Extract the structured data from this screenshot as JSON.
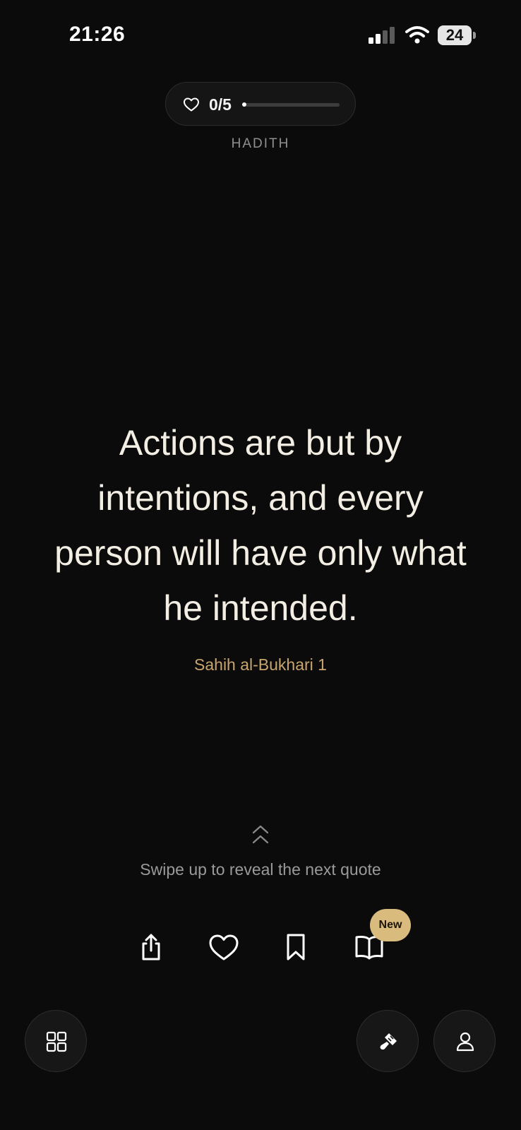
{
  "status_bar": {
    "time": "21:26",
    "battery": "24"
  },
  "progress": {
    "count_text": "0/5",
    "current": 0,
    "total": 5
  },
  "category": "HADITH",
  "quote": {
    "text": "Actions are but by intentions, and every person will have only what he intended.",
    "source": "Sahih al-Bukhari 1"
  },
  "swipe_hint": "Swipe up to reveal the next quote",
  "actions": {
    "new_badge": "New"
  },
  "icons": {
    "pill": "heart-icon",
    "share": "share-icon",
    "like": "heart-icon",
    "save": "bookmark-icon",
    "read": "book-icon",
    "categories": "grid-icon",
    "theme": "brush-icon",
    "profile": "user-icon"
  },
  "colors": {
    "background": "#0b0b0b",
    "quote_text": "#f3eee3",
    "source_accent": "#c9a56e",
    "badge": "#d9bb7d"
  }
}
